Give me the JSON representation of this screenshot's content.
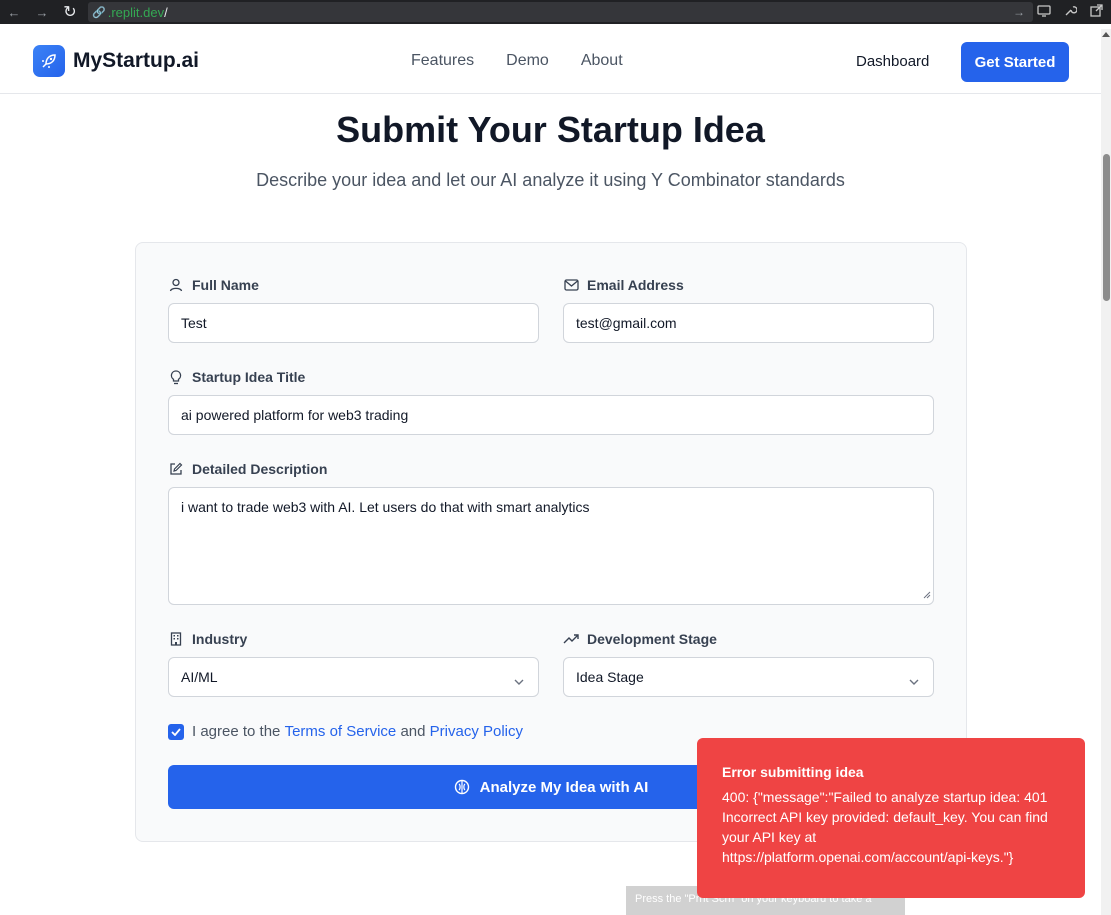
{
  "browser": {
    "url_host": ".replit.dev",
    "url_path": "/"
  },
  "header": {
    "brand": "MyStartup.ai",
    "nav": [
      "Features",
      "Demo",
      "About"
    ],
    "dashboard": "Dashboard",
    "cta": "Get Started"
  },
  "hero": {
    "title": "Submit Your Startup Idea",
    "subtitle": "Describe your idea and let our AI analyze it using Y Combinator standards"
  },
  "form": {
    "full_name": {
      "label": "Full Name",
      "value": "Test"
    },
    "email": {
      "label": "Email Address",
      "value": "test@gmail.com"
    },
    "idea_title": {
      "label": "Startup Idea Title",
      "value": "ai powered platform for web3 trading"
    },
    "description": {
      "label": "Detailed Description",
      "value": "i want to trade web3 with AI. Let users do that with smart analytics"
    },
    "industry": {
      "label": "Industry",
      "value": "AI/ML"
    },
    "stage": {
      "label": "Development Stage",
      "value": "Idea Stage"
    },
    "agree": {
      "checked": true,
      "prefix": "I agree to the",
      "terms": "Terms of Service",
      "and": "and",
      "privacy": "Privacy Policy"
    },
    "submit": "Analyze My Idea with AI"
  },
  "toast": {
    "title": "Error submitting idea",
    "message": "400: {\"message\":\"Failed to analyze startup idea: 401 Incorrect API key provided: default_key. You can find your API key at https://platform.openai.com/account/api-keys.\"}"
  },
  "overlay_hint": "Press the \"Prnt Scrn\" on your keyboard to take a",
  "colors": {
    "primary": "#2563eb",
    "error": "#ef4444",
    "text": "#111827",
    "muted": "#4b5563"
  }
}
